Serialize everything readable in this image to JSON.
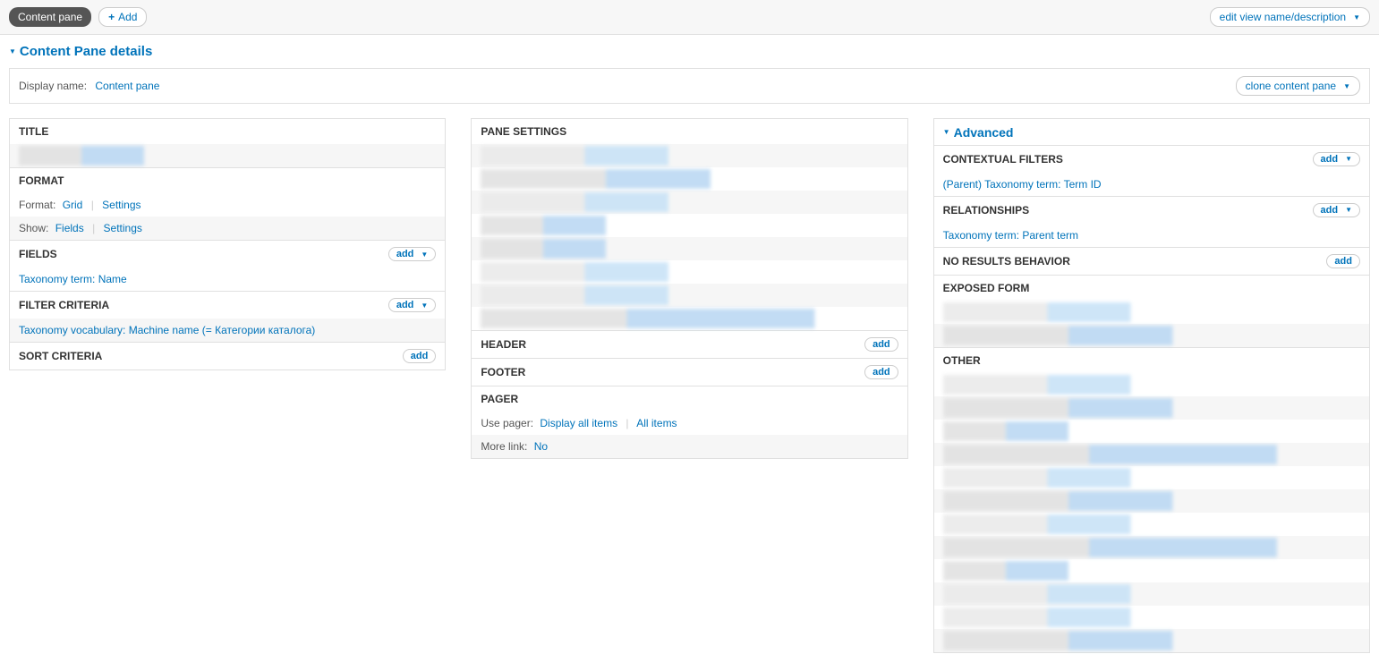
{
  "topbar": {
    "active_tab": "Content pane",
    "add_label": "Add",
    "edit_view_label": "edit view name/description"
  },
  "details": {
    "toggle_label": "Content Pane details",
    "display_name_label": "Display name:",
    "display_name_value": "Content pane",
    "clone_label": "clone content pane"
  },
  "col1": {
    "title_h": "TITLE",
    "format_h": "FORMAT",
    "format_label": "Format:",
    "format_value": "Grid",
    "settings_label": "Settings",
    "show_label": "Show:",
    "show_value": "Fields",
    "fields_h": "FIELDS",
    "field_item": "Taxonomy term: Name",
    "filter_h": "FILTER CRITERIA",
    "filter_item": "Taxonomy vocabulary: Machine name (= Категории каталога)",
    "sort_h": "SORT CRITERIA",
    "add_label": "add"
  },
  "col2": {
    "pane_h": "PANE SETTINGS",
    "header_h": "HEADER",
    "footer_h": "FOOTER",
    "pager_h": "PAGER",
    "use_pager_label": "Use pager:",
    "use_pager_value": "Display all items",
    "use_pager_extra": "All items",
    "more_link_label": "More link:",
    "more_link_value": "No",
    "add_label": "add"
  },
  "col3": {
    "advanced_label": "Advanced",
    "ctx_h": "CONTEXTUAL FILTERS",
    "ctx_item": "(Parent) Taxonomy term: Term ID",
    "rel_h": "RELATIONSHIPS",
    "rel_item": "Taxonomy term: Parent term",
    "noresults_h": "NO RESULTS BEHAVIOR",
    "exposed_h": "EXPOSED FORM",
    "other_h": "OTHER",
    "add_label": "add"
  }
}
